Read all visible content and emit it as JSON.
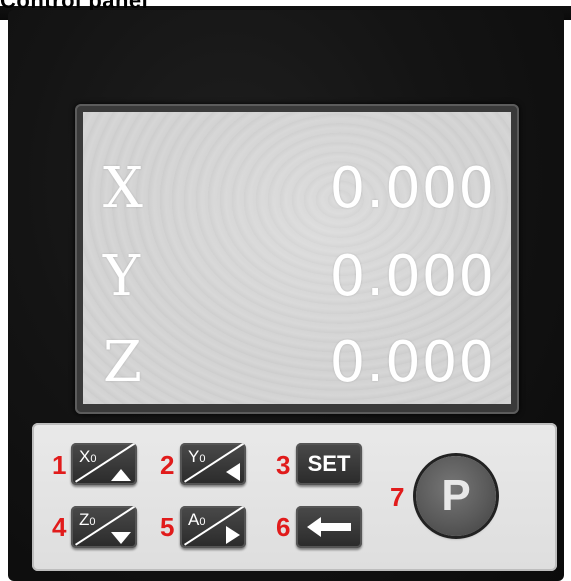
{
  "header": {
    "title": "Control panel"
  },
  "display": {
    "rows": [
      {
        "axis": "X",
        "value": "0.000"
      },
      {
        "axis": "Y",
        "value": "0.000"
      },
      {
        "axis": "Z",
        "value": "0.000"
      }
    ]
  },
  "keypad": {
    "keys": [
      {
        "number": "1",
        "label": "X",
        "subscript": "0",
        "icon": "arrow-up-icon"
      },
      {
        "number": "2",
        "label": "Y",
        "subscript": "0",
        "icon": "arrow-left-icon"
      },
      {
        "number": "3",
        "label": "SET"
      },
      {
        "number": "4",
        "label": "Z",
        "subscript": "0",
        "icon": "arrow-down-icon"
      },
      {
        "number": "5",
        "label": "A",
        "subscript": "0",
        "icon": "arrow-right-icon"
      },
      {
        "number": "6",
        "icon": "enter-arrow-icon"
      },
      {
        "number": "7",
        "label": "P"
      }
    ]
  },
  "colors": {
    "number_label": "#e11b1b",
    "screen_bg": "#d0d0d0",
    "screen_text": "#ffffff"
  }
}
